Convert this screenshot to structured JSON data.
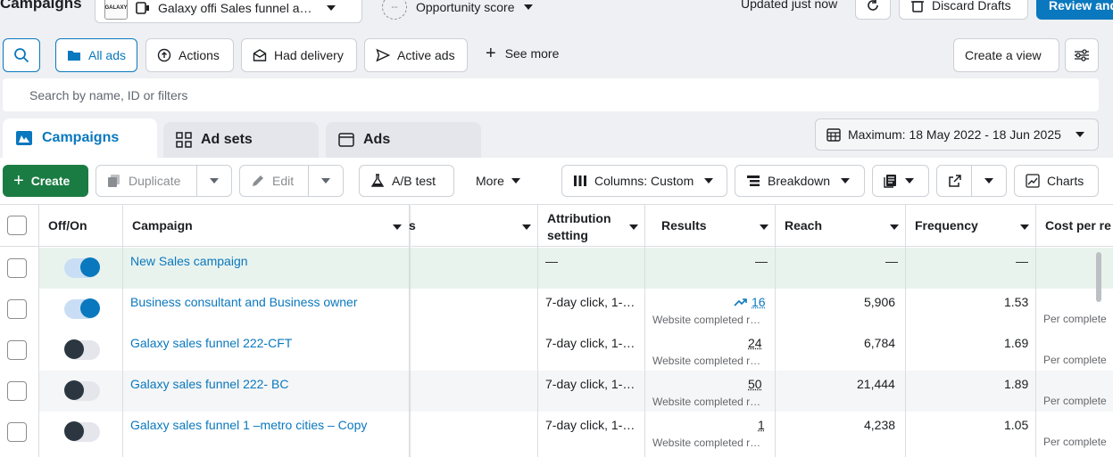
{
  "header": {
    "title": "Campaigns",
    "account": "Galaxy offi Sales funnel a…",
    "opportunity_icon": "--",
    "opportunity": "Opportunity score",
    "updated": "Updated just now",
    "discard": "Discard Drafts",
    "review": "Review and"
  },
  "filters": {
    "all_ads": "All ads",
    "actions": "Actions",
    "had_delivery": "Had delivery",
    "active_ads": "Active ads",
    "see_more": "See more",
    "create_view": "Create a view"
  },
  "search": {
    "placeholder": "Search by name, ID or filters"
  },
  "tabs": [
    {
      "label": "Campaigns"
    },
    {
      "label": "Ad sets"
    },
    {
      "label": "Ads"
    }
  ],
  "date_range": "Maximum: 18 May 2022 - 18 Jun 2025",
  "toolbar": {
    "create": "Create",
    "duplicate": "Duplicate",
    "edit": "Edit",
    "ab_test": "A/B test",
    "more": "More",
    "columns": "Columns: Custom",
    "breakdown": "Breakdown",
    "charts": "Charts"
  },
  "columns": {
    "off_on": "Off/On",
    "campaign": "Campaign",
    "hidden": "s",
    "attribution_1": "Attribution",
    "attribution_2": "setting",
    "results": "Results",
    "reach": "Reach",
    "frequency": "Frequency",
    "cost": "Cost per re"
  },
  "rows": [
    {
      "on": true,
      "name": "New Sales campaign",
      "attribution": "—",
      "results": "—",
      "results_sub": "",
      "reach": "—",
      "frequency": "—",
      "cost_sub": ""
    },
    {
      "on": true,
      "name": "Business consultant and Business owner",
      "attribution": "7-day click, 1-…",
      "results": "16",
      "results_sub": "Website completed r…",
      "reach": "5,906",
      "frequency": "1.53",
      "cost_sub": "Per complete"
    },
    {
      "on": false,
      "name": "Galaxy sales funnel 222-CFT",
      "attribution": "7-day click, 1-…",
      "results": "24",
      "results_sub": "Website completed r…",
      "reach": "6,784",
      "frequency": "1.69",
      "cost_sub": "Per complete"
    },
    {
      "on": false,
      "name": "Galaxy sales funnel 222- BC",
      "attribution": "7-day click, 1-…",
      "results": "50",
      "results_sub": "Website completed r…",
      "reach": "21,444",
      "frequency": "1.89",
      "cost_sub": "Per complete"
    },
    {
      "on": false,
      "name": "Galaxy sales funnel 1 –metro cities – Copy",
      "attribution": "7-day click, 1-…",
      "results": "1",
      "results_sub": "Website completed r…",
      "reach": "4,238",
      "frequency": "1.05",
      "cost_sub": "Per complete"
    }
  ]
}
